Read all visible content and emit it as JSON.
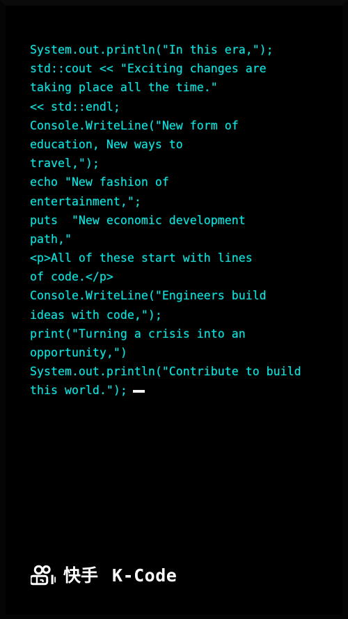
{
  "screen": {
    "background_color": "#000000",
    "code_color": "#12e2dd",
    "brand_color": "#ffffff",
    "cursor_color": "#f2f2f2"
  },
  "editor": {
    "cursor_glyph": "_",
    "lines": [
      "System.out.println(\"In this era,\");",
      "std::cout << \"Exciting changes are",
      "taking place all the time.\"",
      "<< std::endl;",
      "Console.WriteLine(\"New form of",
      "education, New ways to",
      "travel,\");",
      "echo \"New fashion of",
      "entertainment,\";",
      "puts  \"New economic development",
      "path,\"",
      "<p>All of these start with lines",
      "of code.</p>",
      "Console.WriteLine(\"Engineers build",
      "ideas with code,\");",
      "print(\"Turning a crisis into an",
      "opportunity,\")",
      "System.out.println(\"Contribute to build",
      "this world.\");"
    ]
  },
  "footer": {
    "logo_icon": "kuaishou-camera-icon",
    "brand_cn": "快手",
    "brand_en": "K-Code"
  }
}
